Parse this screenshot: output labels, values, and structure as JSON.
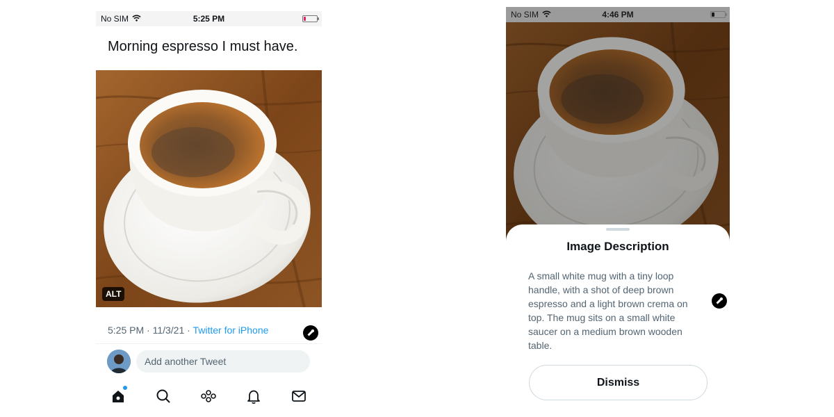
{
  "left_screen": {
    "status_bar": {
      "carrier": "No SIM",
      "time": "5:25 PM",
      "battery_level": 0.15,
      "battery_color": "#e0245e"
    },
    "tweet": {
      "text": "Morning espresso I must have.",
      "alt_badge": "ALT",
      "timestamp": "5:25 PM · 11/3/21 · ",
      "source": "Twitter for iPhone"
    },
    "reply_placeholder": "Add another Tweet",
    "tabbar": {
      "icons": [
        "home-icon",
        "search-icon",
        "spaces-icon",
        "notifications-icon",
        "messages-icon"
      ],
      "home_unread_dot_color": "#1d9bf0"
    }
  },
  "right_screen": {
    "status_bar": {
      "carrier": "No SIM",
      "time": "4:46 PM",
      "battery_level": 0.2
    },
    "sheet": {
      "title": "Image Description",
      "description": "A small white mug with a tiny loop handle, with a shot of deep brown espresso and a light brown crema on top. The mug sits on a small white saucer on a medium brown wooden table.",
      "dismiss_label": "Dismiss"
    }
  },
  "colors": {
    "accent": "#1d9bf0",
    "text_primary": "#0f1419",
    "text_secondary": "#536471",
    "wood": "#8a4f22"
  }
}
